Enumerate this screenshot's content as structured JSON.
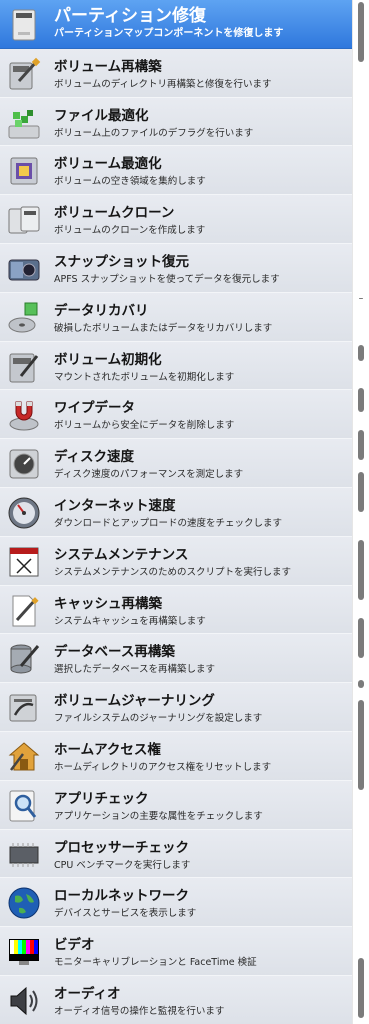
{
  "tools": [
    {
      "title": "パーティション修復",
      "desc": "パーティションマップコンポーネントを修復します",
      "icon": "hard-drive-icon"
    },
    {
      "title": "ボリューム再構築",
      "desc": "ボリュームのディレクトリ再構築と修復を行います",
      "icon": "screwdriver-drive-icon"
    },
    {
      "title": "ファイル最適化",
      "desc": "ボリューム上のファイルのデフラグを行います",
      "icon": "file-blocks-icon"
    },
    {
      "title": "ボリューム最適化",
      "desc": "ボリュームの空き領域を集約します",
      "icon": "chip-drive-icon"
    },
    {
      "title": "ボリュームクローン",
      "desc": "ボリュームのクローンを作成します",
      "icon": "clone-drives-icon"
    },
    {
      "title": "スナップショット復元",
      "desc": "APFS スナップショットを使ってデータを復元します",
      "icon": "camera-icon"
    },
    {
      "title": "データリカバリ",
      "desc": "破損したボリュームまたはデータをリカバリします",
      "icon": "disk-recovery-icon"
    },
    {
      "title": "ボリューム初期化",
      "desc": "マウントされたボリュームを初期化します",
      "icon": "drive-eraser-icon"
    },
    {
      "title": "ワイプデータ",
      "desc": "ボリュームから安全にデータを削除します",
      "icon": "magnet-drive-icon"
    },
    {
      "title": "ディスク速度",
      "desc": "ディスク速度のパフォーマンスを測定します",
      "icon": "drive-gauge-icon"
    },
    {
      "title": "インターネット速度",
      "desc": "ダウンロードとアップロードの速度をチェックします",
      "icon": "speedometer-icon"
    },
    {
      "title": "システムメンテナンス",
      "desc": "システムメンテナンスのためのスクリプトを実行します",
      "icon": "calendar-x-icon"
    },
    {
      "title": "キャッシュ再構築",
      "desc": "システムキャッシュを再構築します",
      "icon": "document-screwdriver-icon"
    },
    {
      "title": "データベース再構築",
      "desc": "選択したデータベースを再構築します",
      "icon": "database-screwdriver-icon"
    },
    {
      "title": "ボリュームジャーナリング",
      "desc": "ファイルシステムのジャーナリングを設定します",
      "icon": "drive-arrow-icon"
    },
    {
      "title": "ホームアクセス権",
      "desc": "ホームディレクトリのアクセス権をリセットします",
      "icon": "home-wrench-icon"
    },
    {
      "title": "アプリチェック",
      "desc": "アプリケーションの主要な属性をチェックします",
      "icon": "magnifier-icon"
    },
    {
      "title": "プロセッサーチェック",
      "desc": "CPU ベンチマークを実行します",
      "icon": "cpu-chip-icon"
    },
    {
      "title": "ローカルネットワーク",
      "desc": "デバイスとサービスを表示します",
      "icon": "globe-icon"
    },
    {
      "title": "ビデオ",
      "desc": "モニターキャリブレーションと FaceTime 検証",
      "icon": "color-bars-icon"
    },
    {
      "title": "オーディオ",
      "desc": "オーディオ信号の操作と監視を行います",
      "icon": "speaker-icon"
    }
  ],
  "selected_index": 0
}
